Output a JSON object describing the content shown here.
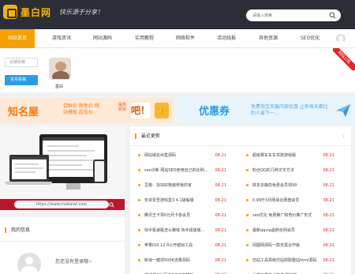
{
  "header": {
    "logo_text": "墨白网",
    "slogan": "快乐源于分享！",
    "search_placeholder": "请输入搜索"
  },
  "nav": {
    "items": [
      "网站首页",
      "游戏资讯",
      "网站源码",
      "实用教程",
      "网络软件",
      "活动线报",
      "其他资源",
      "SEO优化"
    ]
  },
  "profile": {
    "btn_primary": "近期投稿",
    "btn_secondary": "本月投稿",
    "name": "墨白",
    "badge": "网站公告"
  },
  "banners": {
    "left": {
      "title": "知名屋",
      "text": "尝鲜价 限免价 网站模板 超低价",
      "box": "提供 折扣",
      "ba": "吧！",
      "thumb": "👍"
    },
    "right": {
      "title": "优惠券",
      "text": "免费淘宝天猫内部优惠 让你每天都比别人省下一…"
    }
  },
  "showcase": {
    "url": "https://www.mobaiwl.com"
  },
  "info": {
    "title": "我的信息",
    "text": "您还没有登录哦~"
  },
  "latest": {
    "title": "最近更新",
    "more": "›",
    "left": [
      {
        "text": "网站域名出售源码",
        "date": "08-21"
      },
      {
        "text": "seo诊断 网站SEO使用自己的比例…",
        "date": "08-21"
      },
      {
        "text": "豆瓣：找块好物装修我的家",
        "date": "08-21"
      },
      {
        "text": "安卓爱吾游戏盒3.4.1破解版",
        "date": "08-21"
      },
      {
        "text": "腾讯王卡领0元月卡各会员",
        "date": "08-21"
      },
      {
        "text": "快手极速版怎么赚钱 快手极速版…",
        "date": "08-21"
      },
      {
        "text": "苹果iOS 12.4公开越狱工具",
        "date": "08-21"
      },
      {
        "text": "新浪一键领500K流量源码",
        "date": "08-21"
      },
      {
        "text": "测试的404页面GIF动效模板",
        "date": "08-21"
      }
    ],
    "right": [
      {
        "text": "超级赛车车车驾驶游戏版",
        "date": "08-21"
      },
      {
        "text": "粉丝QQ的几种文字方法",
        "date": "08-21"
      },
      {
        "text": "拼多多静态免费会员领99",
        "date": "08-21"
      },
      {
        "text": "0.99升3月网易云网盘会员",
        "date": "08-21"
      },
      {
        "text": "seo优化 免费推广和竞价推广形式",
        "date": "08-21"
      },
      {
        "text": "最新qqvip盗刷全网会员",
        "date": "08-21"
      },
      {
        "text": "阅图网源码一款无需合作版",
        "date": "08-21"
      },
      {
        "text": "仿站工具高级仿站抓取整站html源码",
        "date": "08-21"
      },
      {
        "text": "分享有趣的小软件 黑科技",
        "date": "08-21"
      }
    ]
  },
  "colors": {
    "accent": "#f4a000",
    "header_bg": "#2b2e36",
    "date_red": "#e02828",
    "blue": "#2d9be8",
    "url_bar": "#b9182a"
  }
}
